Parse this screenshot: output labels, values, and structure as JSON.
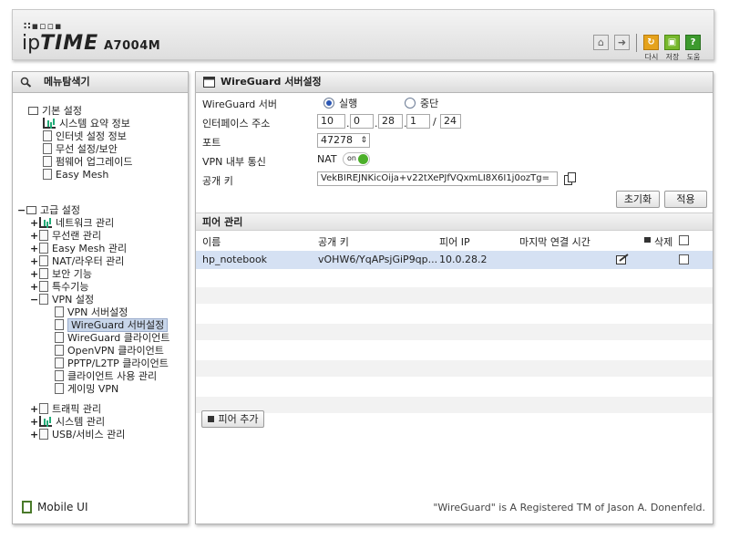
{
  "header": {
    "logo_dots": "∷▪▫▫▪",
    "logo_prefix": "ip",
    "logo_brand": "TIME",
    "model": "A7004M",
    "buttons": [
      {
        "label": "다시"
      },
      {
        "label": "저장"
      },
      {
        "label": "도움"
      }
    ]
  },
  "sidebar": {
    "title": "메뉴탐색기",
    "basic": {
      "label": "기본 설정",
      "items": [
        "시스템 요약 정보",
        "인터넷 설정 정보",
        "무선 설정/보안",
        "펌웨어 업그레이드",
        "Easy Mesh"
      ]
    },
    "advanced": {
      "expander": "−",
      "label": "고급 설정",
      "items": [
        {
          "exp": "+",
          "label": "네트워크 관리"
        },
        {
          "exp": "+",
          "label": "무선랜 관리"
        },
        {
          "exp": "+",
          "label": "Easy Mesh 관리"
        },
        {
          "exp": "+",
          "label": "NAT/라우터 관리"
        },
        {
          "exp": "+",
          "label": "보안 기능"
        },
        {
          "exp": "+",
          "label": "특수기능"
        },
        {
          "exp": "−",
          "label": "VPN 설정"
        }
      ],
      "vpn_items": [
        "VPN 서버설정",
        "WireGuard 서버설정",
        "WireGuard 클라이언트",
        "OpenVPN 클라이언트",
        "PPTP/L2TP 클라이언트",
        "클라이언트 사용 관리",
        "게이밍 VPN"
      ],
      "after_items": [
        {
          "exp": "+",
          "label": "트래픽 관리"
        },
        {
          "exp": "+",
          "label": "시스템 관리"
        },
        {
          "exp": "+",
          "label": "USB/서비스 관리"
        }
      ]
    },
    "mobile_ui": "Mobile UI"
  },
  "main": {
    "title": "WireGuard 서버설정",
    "server_label": "WireGuard 서버",
    "run_label": "실행",
    "stop_label": "중단",
    "iface_label": "인터페이스 주소",
    "ip": [
      "10",
      "0",
      "28",
      "1"
    ],
    "mask": "24",
    "port_label": "포트",
    "port": "47278",
    "vpn_internal_label": "VPN 내부 통신",
    "nat_label": "NAT",
    "toggle_label": "on",
    "pubkey_label": "공개 키",
    "pubkey": "VekBIREJNKicOija+v22tXePJfVQxmLI8X6I1j0ozTg=",
    "reset_button": "초기화",
    "apply_button": "적용",
    "peer_section": "피어 관리",
    "columns": [
      "이름",
      "공개 키",
      "피어 IP",
      "마지막 연결 시간",
      "삭제"
    ],
    "peers": [
      {
        "name": "hp_notebook",
        "pubkey": "vOHW6/YqAPsjGiP9qp...",
        "ip": "10.0.28.2",
        "last": ""
      }
    ],
    "add_peer_button": "피어 추가",
    "footer": "\"WireGuard\" is A Registered TM of Jason A. Donenfeld."
  },
  "colors": {
    "accent": "#2a56b5",
    "selected_row": "#d5e1f3",
    "toggle_on": "#4caf2a"
  }
}
